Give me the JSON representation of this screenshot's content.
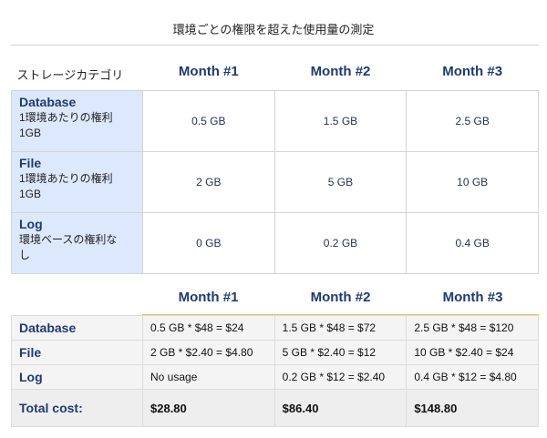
{
  "title": "環境ごとの権限を超えた使用量の測定",
  "table1": {
    "category_header": "ストレージカテゴリ",
    "months": [
      "Month #1",
      "Month #2",
      "Month #3"
    ],
    "rows": [
      {
        "name": "Database",
        "desc1": "1環境あたりの権利",
        "desc2": "1GB",
        "values": [
          "0.5 GB",
          "1.5 GB",
          "2.5 GB"
        ]
      },
      {
        "name": "File",
        "desc1": "1環境あたりの権利",
        "desc2": "1GB",
        "values": [
          "2 GB",
          "5 GB",
          "10 GB"
        ]
      },
      {
        "name": "Log",
        "desc1": "環境ベースの権利な",
        "desc2": "し",
        "values": [
          "0 GB",
          "0.2 GB",
          "0.4 GB"
        ]
      }
    ]
  },
  "table2": {
    "months": [
      "Month #1",
      "Month #2",
      "Month #3"
    ],
    "rows": [
      {
        "name": "Database",
        "values": [
          "0.5 GB * $48 = $24",
          "1.5 GB * $48 = $72",
          "2.5 GB * $48 = $120"
        ]
      },
      {
        "name": "File",
        "values": [
          "2 GB * $2.40 = $4.80",
          "5 GB * $2.40 = $12",
          "10 GB * $2.40 = $24"
        ]
      },
      {
        "name": "Log",
        "values": [
          "No usage",
          "0.2 GB * $12 = $2.40",
          "0.4 GB * $12 = $4.80"
        ]
      }
    ],
    "total": {
      "name": "Total cost:",
      "values": [
        "$28.80",
        "$86.40",
        "$148.80"
      ]
    }
  }
}
